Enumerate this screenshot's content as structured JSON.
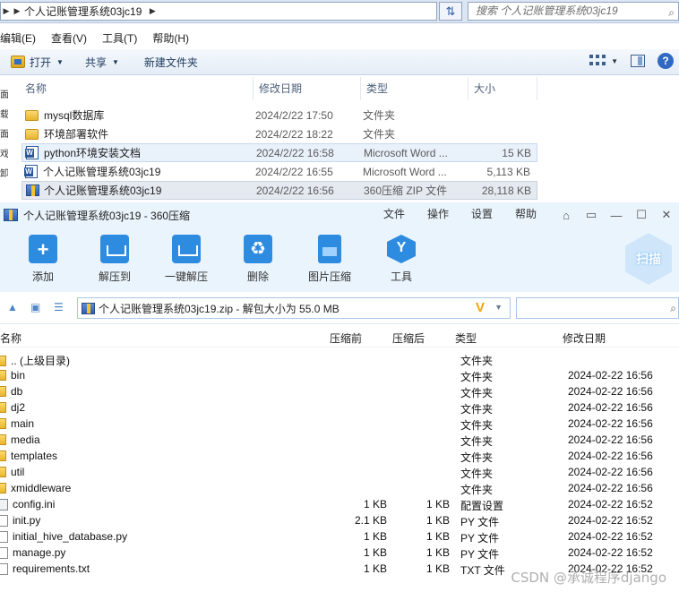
{
  "explorer": {
    "breadcrumb": [
      "个人记账管理系统03jc19"
    ],
    "search_placeholder": "搜索 个人记账管理系统03jc19",
    "menu": [
      "编辑(E)",
      "查看(V)",
      "工具(T)",
      "帮助(H)"
    ],
    "toolbar": {
      "open": "打开",
      "share": "共享",
      "new_folder": "新建文件夹"
    },
    "columns": {
      "name": "名称",
      "date": "修改日期",
      "type": "类型",
      "size": "大小"
    },
    "left_strip": [
      "面",
      "载",
      "面",
      "戏",
      "卸"
    ],
    "files": [
      {
        "icon": "folder-icon",
        "name": "mysql数据库",
        "date": "2024/2/22 17:50",
        "type": "文件夹",
        "size": ""
      },
      {
        "icon": "folder-icon",
        "name": "环境部署软件",
        "date": "2024/2/22 18:22",
        "type": "文件夹",
        "size": ""
      },
      {
        "icon": "word-doc-icon",
        "name": "python环境安装文档",
        "date": "2024/2/22 16:58",
        "type": "Microsoft Word ...",
        "size": "15 KB"
      },
      {
        "icon": "word-doc-icon",
        "name": "个人记账管理系统03jc19",
        "date": "2024/2/22 16:55",
        "type": "Microsoft Word ...",
        "size": "5,113 KB"
      },
      {
        "icon": "zip-archive-icon",
        "name": "个人记账管理系统03jc19",
        "date": "2024/2/22 16:56",
        "type": "360压缩 ZIP 文件",
        "size": "28,118 KB"
      }
    ]
  },
  "zip": {
    "title": "个人记账管理系统03jc19 - 360压缩",
    "menu": [
      "文件",
      "操作",
      "设置",
      "帮助"
    ],
    "tools": [
      "添加",
      "解压到",
      "一键解压",
      "删除",
      "图片压缩",
      "工具"
    ],
    "scan": "扫描",
    "path": "个人记账管理系统03jc19.zip - 解包大小为 55.0 MB",
    "columns": {
      "name": "名称",
      "before": "压缩前",
      "after": "压缩后",
      "type": "类型",
      "modified": "修改日期"
    },
    "rows": [
      {
        "icon": "folder",
        "name": ".. (上级目录)",
        "before": "",
        "after": "",
        "type": "文件夹",
        "modified": ""
      },
      {
        "icon": "folder",
        "name": "bin",
        "before": "",
        "after": "",
        "type": "文件夹",
        "modified": "2024-02-22 16:56"
      },
      {
        "icon": "folder",
        "name": "db",
        "before": "",
        "after": "",
        "type": "文件夹",
        "modified": "2024-02-22 16:56"
      },
      {
        "icon": "folder",
        "name": "dj2",
        "before": "",
        "after": "",
        "type": "文件夹",
        "modified": "2024-02-22 16:56"
      },
      {
        "icon": "folder",
        "name": "main",
        "before": "",
        "after": "",
        "type": "文件夹",
        "modified": "2024-02-22 16:56"
      },
      {
        "icon": "folder",
        "name": "media",
        "before": "",
        "after": "",
        "type": "文件夹",
        "modified": "2024-02-22 16:56"
      },
      {
        "icon": "folder",
        "name": "templates",
        "before": "",
        "after": "",
        "type": "文件夹",
        "modified": "2024-02-22 16:56"
      },
      {
        "icon": "folder",
        "name": "util",
        "before": "",
        "after": "",
        "type": "文件夹",
        "modified": "2024-02-22 16:56"
      },
      {
        "icon": "folder",
        "name": "xmiddleware",
        "before": "",
        "after": "",
        "type": "文件夹",
        "modified": "2024-02-22 16:56"
      },
      {
        "icon": "config",
        "name": "config.ini",
        "before": "1 KB",
        "after": "1 KB",
        "type": "配置设置",
        "modified": "2024-02-22 16:52"
      },
      {
        "icon": "doc",
        "name": "init.py",
        "before": "2.1 KB",
        "after": "1 KB",
        "type": "PY 文件",
        "modified": "2024-02-22 16:52"
      },
      {
        "icon": "doc",
        "name": "initial_hive_database.py",
        "before": "1 KB",
        "after": "1 KB",
        "type": "PY 文件",
        "modified": "2024-02-22 16:52"
      },
      {
        "icon": "doc",
        "name": "manage.py",
        "before": "1 KB",
        "after": "1 KB",
        "type": "PY 文件",
        "modified": "2024-02-22 16:52"
      },
      {
        "icon": "doc",
        "name": "requirements.txt",
        "before": "1 KB",
        "after": "1 KB",
        "type": "TXT 文件",
        "modified": "2024-02-22 16:52"
      }
    ],
    "watermark": "CSDN @承诚程序django"
  }
}
